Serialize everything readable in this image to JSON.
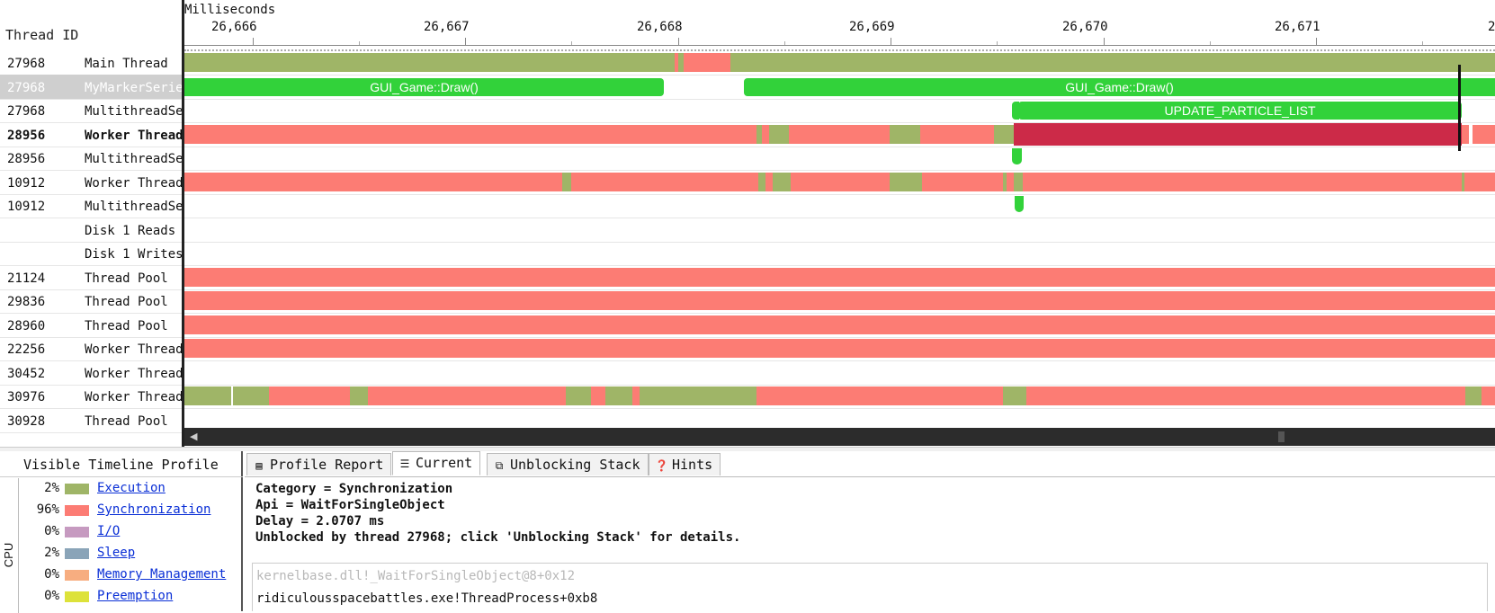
{
  "thread_list": {
    "header": "Thread ID",
    "rows": [
      {
        "id": "27968",
        "name": "Main Thread"
      },
      {
        "id": "27968",
        "name": "MyMarkerSeries"
      },
      {
        "id": "27968",
        "name": "MultithreadSeries"
      },
      {
        "id": "28956",
        "name": "Worker Thread"
      },
      {
        "id": "28956",
        "name": "MultithreadSeries"
      },
      {
        "id": "10912",
        "name": "Worker Thread"
      },
      {
        "id": "10912",
        "name": "MultithreadSeries"
      },
      {
        "id": "",
        "name": "Disk 1 Reads"
      },
      {
        "id": "",
        "name": "Disk 1 Writes"
      },
      {
        "id": "21124",
        "name": "Thread Pool"
      },
      {
        "id": "29836",
        "name": "Thread Pool"
      },
      {
        "id": "28960",
        "name": "Thread Pool"
      },
      {
        "id": "22256",
        "name": "Worker Thread"
      },
      {
        "id": "30452",
        "name": "Worker Thread"
      },
      {
        "id": "30976",
        "name": "Worker Thread"
      },
      {
        "id": "30928",
        "name": "Thread Pool"
      }
    ]
  },
  "timeline": {
    "axis_title": "Milliseconds",
    "ticks": [
      "26,666",
      "26,667",
      "26,668",
      "26,669",
      "26,670",
      "26,671",
      "2"
    ],
    "markers": {
      "draw1": "GUI_Game::Draw()",
      "draw2": "GUI_Game::Draw()",
      "particle": "UPDATE_PARTICLE_LIST"
    }
  },
  "legend": {
    "title": "Visible Timeline Profile",
    "axis_label": "CPU",
    "items": [
      {
        "pct": "2%",
        "label": "Execution",
        "color": "#9fb567"
      },
      {
        "pct": "96%",
        "label": "Synchronization",
        "color": "#fc7c74"
      },
      {
        "pct": "0%",
        "label": "I/O",
        "color": "#c69ac0"
      },
      {
        "pct": "2%",
        "label": "Sleep",
        "color": "#8aa4b8"
      },
      {
        "pct": "0%",
        "label": "Memory Management",
        "color": "#f7ad80"
      },
      {
        "pct": "0%",
        "label": "Preemption",
        "color": "#dde23a"
      }
    ]
  },
  "details": {
    "tabs": {
      "profile_report": "Profile Report",
      "current": "Current",
      "unblocking_stack": "Unblocking Stack",
      "hints": "Hints"
    },
    "lines": {
      "category": "Category = Synchronization",
      "api": "Api = WaitForSingleObject",
      "delay": "Delay = 2.0707 ms",
      "unblocked": "Unblocked by thread 27968; click 'Unblocking Stack' for details."
    },
    "stack": [
      "kernelbase.dll!_WaitForSingleObject@8+0x12",
      "ridiculousspacebattles.exe!ThreadProcess+0xb8"
    ]
  }
}
